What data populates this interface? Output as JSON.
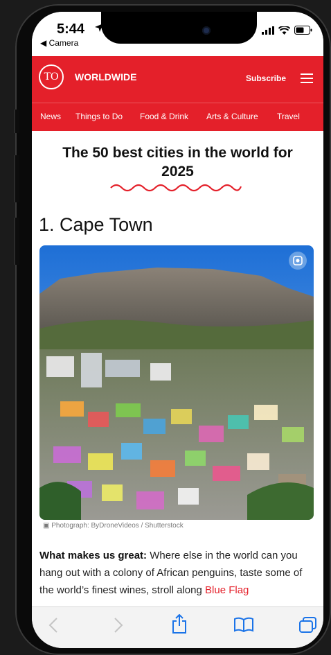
{
  "status": {
    "time": "5:44",
    "back_label": "◀ Camera"
  },
  "header": {
    "brand": "WORLDWIDE",
    "logo_text": "TO",
    "subscribe": "Subscribe",
    "nav": [
      "News",
      "Things to Do",
      "Food & Drink",
      "Arts & Culture",
      "Travel"
    ]
  },
  "article": {
    "title": "The 50 best cities in the world for 2025",
    "heading": "1. Cape Town",
    "caption": "Photograph: ByDroneVideos / Shutterstock",
    "body_bold": "What makes us great:",
    "body_text": " Where else in the world can you hang out with a colony of African penguins, taste some of the world’s finest wines, stroll along ",
    "body_link": "Blue Flag"
  },
  "toolbar": {
    "icons": [
      "back-icon",
      "forward-icon",
      "share-icon",
      "bookmarks-icon",
      "tabs-icon"
    ]
  },
  "colors": {
    "brand_red": "#e4202a",
    "background": "#1b1b1b"
  }
}
